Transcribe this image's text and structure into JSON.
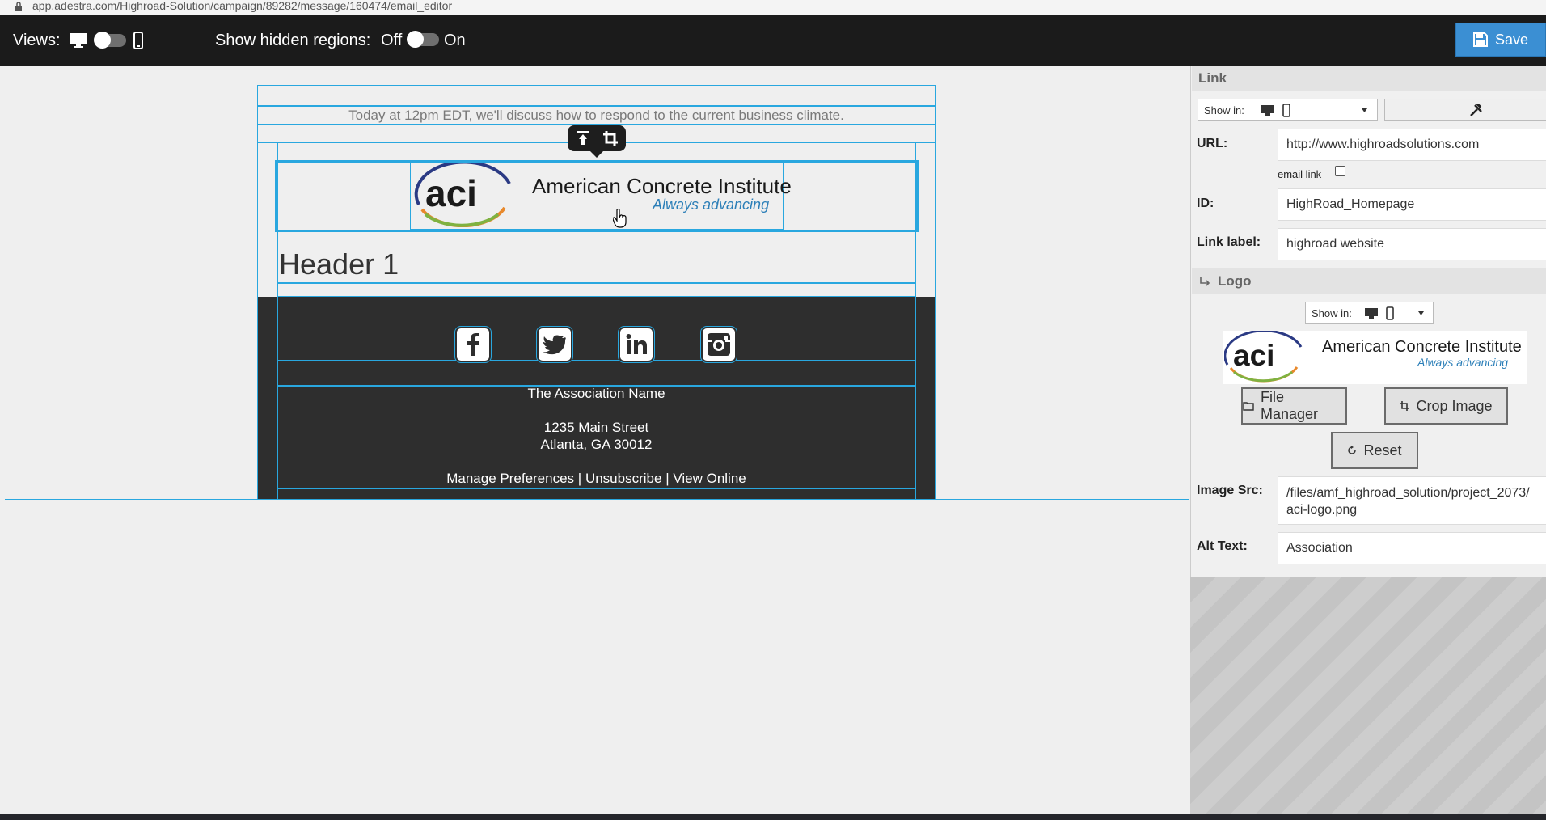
{
  "browser": {
    "url": "app.adestra.com/Highroad-Solution/campaign/89282/message/160474/email_editor"
  },
  "toolbar": {
    "views_label": "Views:",
    "hidden_regions_label": "Show hidden regions:",
    "off_label": "Off",
    "on_label": "On",
    "save_label": "Save"
  },
  "email": {
    "preheader": "Today at 12pm EDT, we'll discuss how to respond to the current business climate.",
    "logo": {
      "mark": "aci",
      "name": "American Concrete Institute",
      "tagline": "Always advancing"
    },
    "header": "Header 1",
    "social_icons": [
      "facebook-icon",
      "twitter-icon",
      "linkedin-icon",
      "instagram-icon"
    ],
    "footer": {
      "org_name": "The Association Name",
      "address_line1": "1235 Main Street",
      "address_line2": "Atlanta, GA 30012",
      "manage": "Manage Preferences",
      "sep1": "|",
      "unsubscribe": "Unsubscribe",
      "sep2": "|",
      "view_online": "View Online"
    }
  },
  "panel": {
    "link_section": {
      "title": "Link",
      "show_in_label": "Show in:",
      "url_label": "URL:",
      "url_value": "http://www.highroadsolutions.com",
      "email_link_label": "email link",
      "id_label": "ID:",
      "id_value": "HighRoad_Homepage",
      "link_label_label": "Link label:",
      "link_label_value": "highroad website"
    },
    "logo_section": {
      "title": "Logo",
      "show_in_label": "Show in:",
      "file_manager": "File Manager",
      "crop_image": "Crop Image",
      "reset": "Reset",
      "image_src_label": "Image Src:",
      "image_src_value_line1": "/files/amf_highroad_solution/project_2073/",
      "image_src_value_line2": "aci-logo.png",
      "alt_text_label": "Alt Text:",
      "alt_text_value": "Association"
    }
  },
  "colors": {
    "accent": "#29a7df",
    "save_button": "#3b8fd3",
    "toolbar": "#1b1b1b",
    "footer_bg": "#2e2e2e"
  }
}
